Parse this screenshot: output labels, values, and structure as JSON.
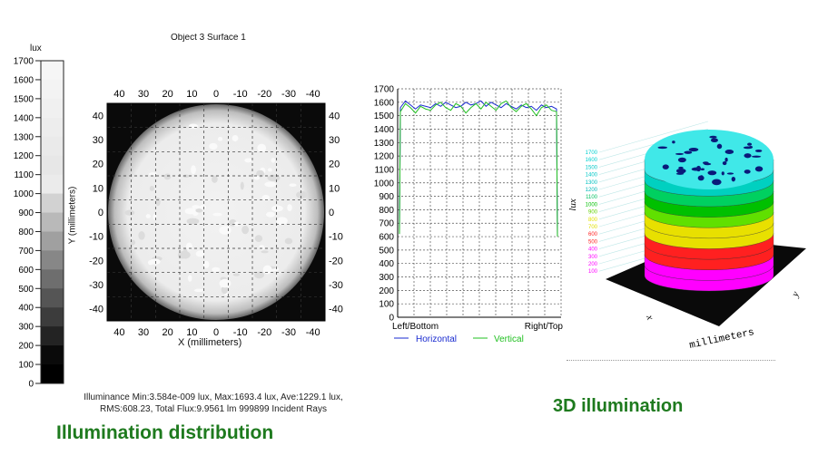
{
  "captions": {
    "left": "Illumination distribution",
    "right": "3D illumination"
  },
  "colorbar": {
    "unit": "lux",
    "ticks": [
      "1700",
      "1600",
      "1500",
      "1400",
      "1300",
      "1200",
      "1100",
      "1000",
      "900",
      "800",
      "700",
      "600",
      "500",
      "400",
      "300",
      "200",
      "100",
      "0"
    ]
  },
  "map": {
    "title": "Object 3 Surface 1",
    "x_label": "X (millimeters)",
    "y_label": "Y (millimeters)",
    "x_ticks": [
      "40",
      "30",
      "20",
      "10",
      "0",
      "-10",
      "-20",
      "-30",
      "-40"
    ],
    "y_ticks": [
      "40",
      "30",
      "20",
      "10",
      "0",
      "-10",
      "-20",
      "-30",
      "-40"
    ],
    "stats_line1": "Illuminance Min:3.584e-009 lux, Max:1693.4 lux, Ave:1229.1 lux,",
    "stats_line2": "RMS:608.23, Total Flux:9.9561 lm 999899 Incident Rays"
  },
  "profile": {
    "x_left": "Left/Bottom",
    "x_right": "Right/Top",
    "legend_h": "Horizontal",
    "legend_v": "Vertical"
  },
  "surface3d": {
    "z_label": "lux",
    "x_label": "x",
    "y_label": "y",
    "axis_label": "millimeters",
    "scale_ticks": [
      "1700",
      "1600",
      "1500",
      "1400",
      "1300",
      "1200",
      "1100",
      "1000",
      "900",
      "800",
      "700",
      "600",
      "500",
      "400",
      "300",
      "200",
      "100"
    ]
  },
  "chart_data": [
    {
      "type": "heatmap",
      "title": "Object 3 Surface 1",
      "xlabel": "X (millimeters)",
      "ylabel": "Y (millimeters)",
      "xlim": [
        40,
        -40
      ],
      "ylim": [
        -40,
        40
      ],
      "colorbar_unit": "lux",
      "colorbar_range": [
        0,
        1700
      ],
      "grid": true
    },
    {
      "type": "line",
      "ylim": [
        0,
        1700
      ],
      "yticks": [
        0,
        100,
        200,
        300,
        400,
        500,
        600,
        700,
        800,
        900,
        1000,
        1100,
        1200,
        1300,
        1400,
        1500,
        1600,
        1700
      ],
      "x_positions": [
        "Left/Bottom",
        "Right/Top"
      ],
      "series": [
        {
          "name": "Horizontal",
          "color": "#1a2bd0",
          "values": [
            1560,
            1610,
            1580,
            1550,
            1580,
            1570,
            1560,
            1590,
            1570,
            1600,
            1580,
            1560,
            1570,
            1600,
            1580,
            1590,
            1610,
            1570,
            1600,
            1580,
            1560,
            1590,
            1570,
            1550,
            1580,
            1560,
            1570,
            1540,
            1580,
            1560,
            1570,
            1550
          ]
        },
        {
          "name": "Vertical",
          "color": "#22c022",
          "values": [
            1530,
            1590,
            1560,
            1520,
            1570,
            1550,
            1540,
            1580,
            1600,
            1560,
            1540,
            1590,
            1570,
            1520,
            1560,
            1590,
            1550,
            1600,
            1570,
            1540,
            1590,
            1610,
            1560,
            1530,
            1570,
            1590,
            1550,
            1500,
            1560,
            1580,
            1540,
            1530
          ]
        }
      ],
      "grid": true,
      "legend": "bottom"
    },
    {
      "type": "area",
      "zlabel": "lux",
      "axis_label": "millimeters",
      "zlim": [
        100,
        1700
      ],
      "band_colors": [
        "#ff00ff",
        "#ff00ff",
        "#ff2020",
        "#ff2020",
        "#e8e000",
        "#e8e000",
        "#60e000",
        "#00c000",
        "#00d060",
        "#00d0c0",
        "#40e8e8"
      ]
    }
  ]
}
